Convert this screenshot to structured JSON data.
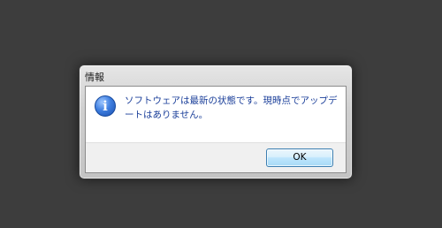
{
  "dialog": {
    "title": "情報",
    "icon": "info-icon",
    "message": "ソフトウェアは最新の状態です。現時点でアップデートはありません。",
    "ok_label": "OK"
  }
}
